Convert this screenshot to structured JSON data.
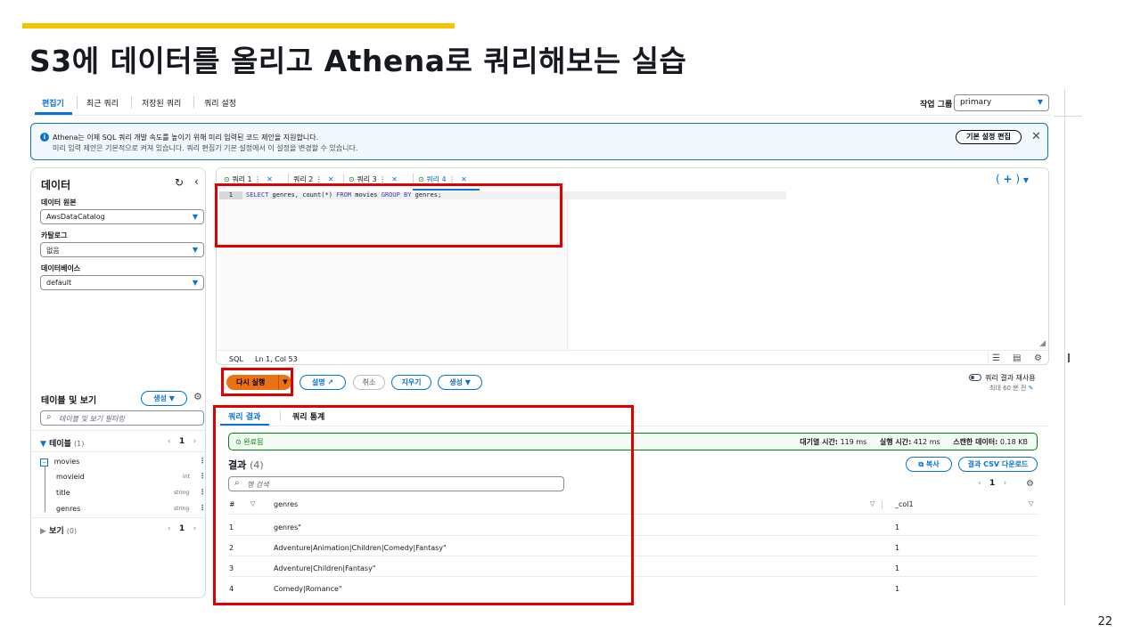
{
  "slide": {
    "title": "S3에 데이터를 올리고 Athena로 쿼리해보는 실습",
    "page_number": "22"
  },
  "nav": {
    "tabs": [
      "편집기",
      "최근 쿼리",
      "저장된 쿼리",
      "쿼리 설정"
    ],
    "workgroup_label": "작업 그룹",
    "workgroup_value": "primary"
  },
  "notice": {
    "line1": "Athena는 이제 SQL 쿼리 개발 속도를 높이기 위해 미리 입력된 코드 제안을 지원합니다.",
    "line2": "미리 입력 제안은 기본적으로 켜져 있습니다. 쿼리 편집기 기본 설정에서 이 설정을 변경할 수 있습니다.",
    "button": "기본 설정 편집"
  },
  "sidebar": {
    "title": "데이터",
    "data_source_label": "데이터 원본",
    "data_source_value": "AwsDataCatalog",
    "catalog_label": "카탈로그",
    "catalog_value": "없음",
    "database_label": "데이터베이스",
    "database_value": "default",
    "tables_views_label": "테이블 및 보기",
    "create_label": "생성",
    "filter_placeholder": "테이블 및 보기 필터링",
    "tables_label": "테이블",
    "tables_count": "(1)",
    "page": "1",
    "table_name": "movies",
    "columns": [
      {
        "name": "movieid",
        "type": "int"
      },
      {
        "name": "title",
        "type": "string"
      },
      {
        "name": "genres",
        "type": "string"
      }
    ],
    "views_label": "보기",
    "views_count": "(0)",
    "views_page": "1"
  },
  "editor": {
    "tabs": [
      "쿼리 1",
      "쿼리 2",
      "쿼리 3",
      "쿼리 4"
    ],
    "line_number": "1",
    "code_kw1": "SELECT",
    "code_p1": " genres, count(*) ",
    "code_kw2": "FROM",
    "code_p2": " movies ",
    "code_kw3": "GROUP BY",
    "code_p3": " genres;",
    "status_lang": "SQL",
    "status_pos": "Ln 1, Col 53"
  },
  "actions": {
    "run": "다시 실행",
    "explain": "설명",
    "cancel": "취소",
    "clear": "지우기",
    "create": "생성",
    "reuse_label": "쿼리 결과 재사용",
    "reuse_sub": "최대 60 분 전"
  },
  "results": {
    "tabs": [
      "쿼리 결과",
      "쿼리 통계"
    ],
    "status": "완료됨",
    "queue_label": "대기열 시간:",
    "queue_value": "119 ms",
    "run_label": "실행 시간:",
    "run_value": "412 ms",
    "scan_label": "스캔한 데이터:",
    "scan_value": "0.18 KB",
    "title": "결과",
    "count": "(4)",
    "copy": "복사",
    "download": "결과 CSV 다운로드",
    "search_placeholder": "행 검색",
    "page": "1",
    "columns": [
      "#",
      "genres",
      "_col1"
    ],
    "rows": [
      [
        "1",
        "genres\"",
        "1"
      ],
      [
        "2",
        "Adventure|Animation|Children|Comedy|Fantasy\"",
        "1"
      ],
      [
        "3",
        "Adventure|Children|Fantasy\"",
        "1"
      ],
      [
        "4",
        "Comedy|Romance\"",
        "1"
      ]
    ]
  }
}
